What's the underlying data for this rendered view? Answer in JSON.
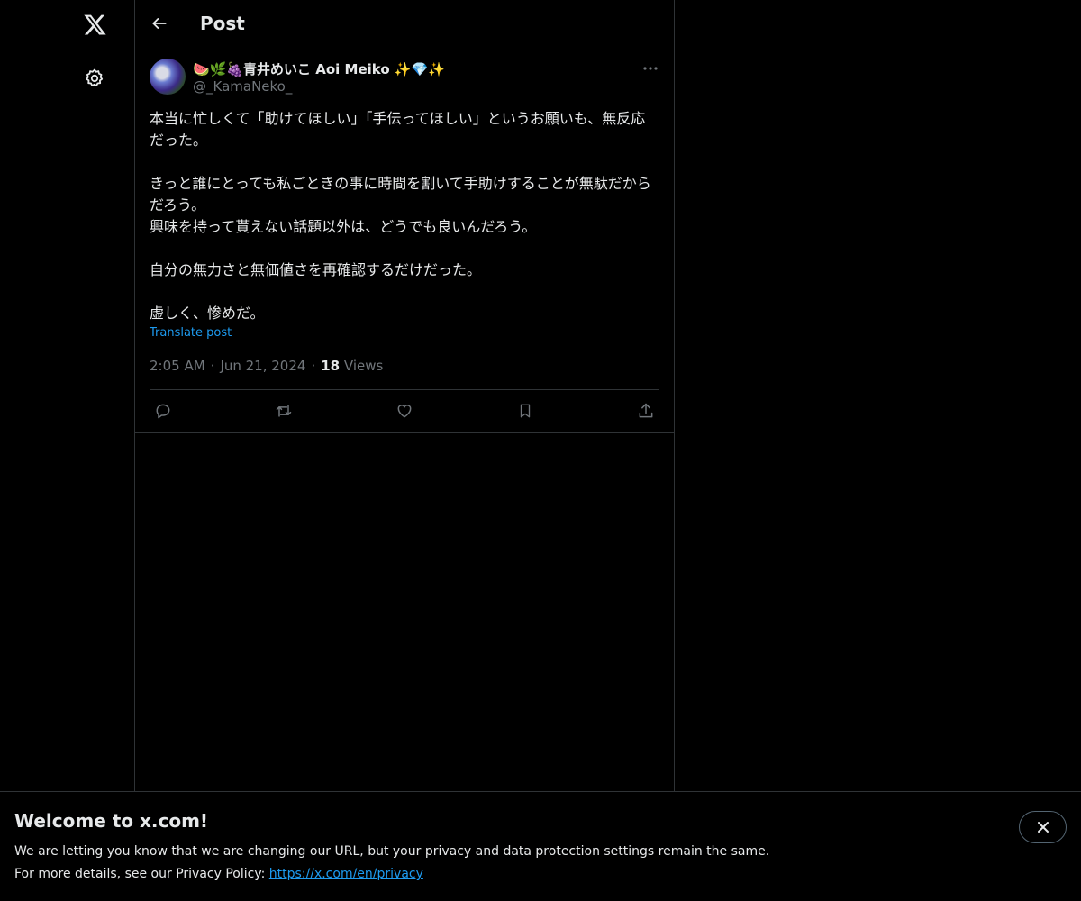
{
  "colors": {
    "background": "#000000",
    "text": "#e7e9ea",
    "muted": "#71767b",
    "accent": "#1d9bf0",
    "border": "#2f3336"
  },
  "sidebar": {
    "logo_icon": "x-logo-icon",
    "settings_icon": "gear-icon"
  },
  "header": {
    "back_icon": "back-arrow-icon",
    "title": "Post"
  },
  "post": {
    "author": {
      "display_name": "🍉🌿🍇青井めいこ Aoi Meiko ✨💎✨",
      "handle": "@_KamaNeko_"
    },
    "text": "本当に忙しくて「助けてほしい」「手伝ってほしい」というお願いも、無反応だった。\n\nきっと誰にとっても私ごときの事に時間を割いて手助けすることが無駄だからだろう。\n興味を持って貰えない話題以外は、どうでも良いんだろう。\n\n自分の無力さと無価値さを再確認するだけだった。\n\n虚しく、惨めだ。",
    "translate_label": "Translate post",
    "time": "2:05 AM",
    "date": "Jun 21, 2024",
    "views_count": "18",
    "views_label": "Views",
    "actions": [
      "reply-icon",
      "repost-icon",
      "like-icon",
      "bookmark-icon",
      "share-icon"
    ]
  },
  "banner": {
    "title": "Welcome to x.com!",
    "line1": "We are letting you know that we are changing our URL, but your privacy and data protection settings remain the same.",
    "line2_prefix": "For more details, see our Privacy Policy: ",
    "link": "https://x.com/en/privacy",
    "close_icon": "close-icon"
  }
}
